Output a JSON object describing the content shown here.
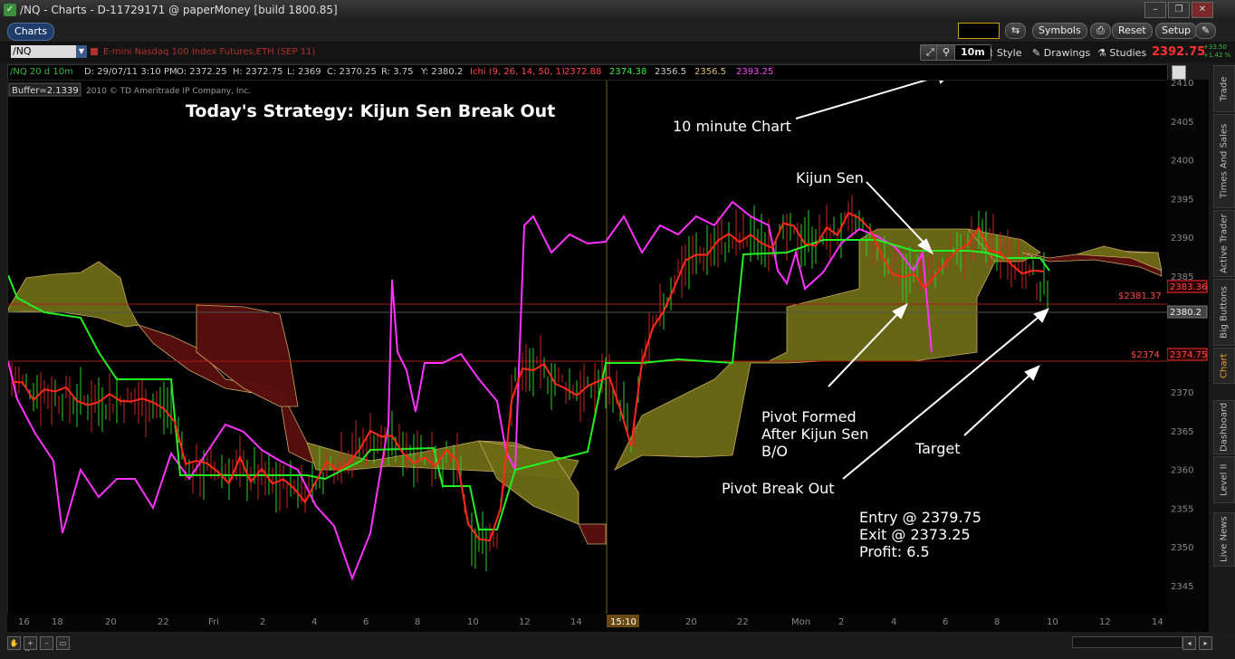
{
  "window": {
    "title": "/NQ - Charts - D-11729171 @ paperMoney [build 1800.85]",
    "buttons": [
      "–",
      "❐",
      "✕"
    ]
  },
  "toolbar": {
    "tab_label": "Charts",
    "symbols_label": "Symbols",
    "reset_label": "Reset",
    "setup_label": "Setup"
  },
  "symbolbar": {
    "symbol": "/NQ",
    "description": "E-mini Nasdaq 100 Index Futures,ETH (SEP 11)",
    "period": "10m",
    "style_label": "Style",
    "drawings_label": "Drawings",
    "studies_label": "Studies",
    "last_price": "2392.75",
    "net_change": "+33.50",
    "pct_change": "+1.42 %"
  },
  "status": {
    "period": "/NQ 20 d 10m",
    "date": "D: 29/07/11 3:10 PM",
    "open": "O: 2372.25",
    "high": "H: 2372.75",
    "low": "L: 2369",
    "close": "C: 2370.25",
    "range": "R: 3.75",
    "y": "Y: 2380.2",
    "ichi": "Ichi (9, 26, 14, 50, 1)",
    "v1": "2372.88",
    "v2": "2374.38",
    "v3": "2356.5",
    "v4": "2356.5",
    "v5": "2393.25"
  },
  "chart": {
    "buffer": "Buffer=2.1339",
    "copyright": "2010 © TD Ameritrade IP Company, Inc.",
    "headline": "Today's Strategy: Kijun Sen Break Out",
    "annotations": {
      "a10min": "10 minute Chart",
      "kijun": "Kijun Sen",
      "pivot1": "Pivot Formed",
      "pivot2": "After Kijun Sen",
      "pivot3": "B/O",
      "target": "Target",
      "pbo": "Pivot Break Out",
      "entry": "Entry @ 2379.75",
      "exit": "Exit @ 2373.25",
      "profit": "Profit: 6.5"
    },
    "levels": {
      "l1_label": "$2381.37",
      "l1_badge": "2383.36",
      "l2_badge": "2380.2",
      "l3_label": "$2374",
      "l3_badge": "2374.75"
    },
    "y_ticks": [
      "2410",
      "2405",
      "2400",
      "2395",
      "2390",
      "2385",
      "2380",
      "2375",
      "2370",
      "2365",
      "2360",
      "2355",
      "2350",
      "2345"
    ],
    "x_ticks": [
      "16",
      "18",
      "20",
      "22",
      "Fri",
      "2",
      "4",
      "6",
      "8",
      "10",
      "12",
      "14",
      "15:10",
      "20",
      "22",
      "Mon",
      "2",
      "4",
      "6",
      "8",
      "10",
      "12",
      "14"
    ]
  },
  "right_tabs": [
    "Trade",
    "Times And Sales",
    "Active Trader",
    "Big Buttons",
    "Chart",
    "Dashboard",
    "Level II",
    "Live News"
  ],
  "colors": {
    "kijun": "#ff2a1a",
    "tenkan": "#22ee22",
    "chikou": "#ff33ff",
    "cloud_bull": "#6b6b16",
    "cloud_bear": "#5a0f0f"
  }
}
